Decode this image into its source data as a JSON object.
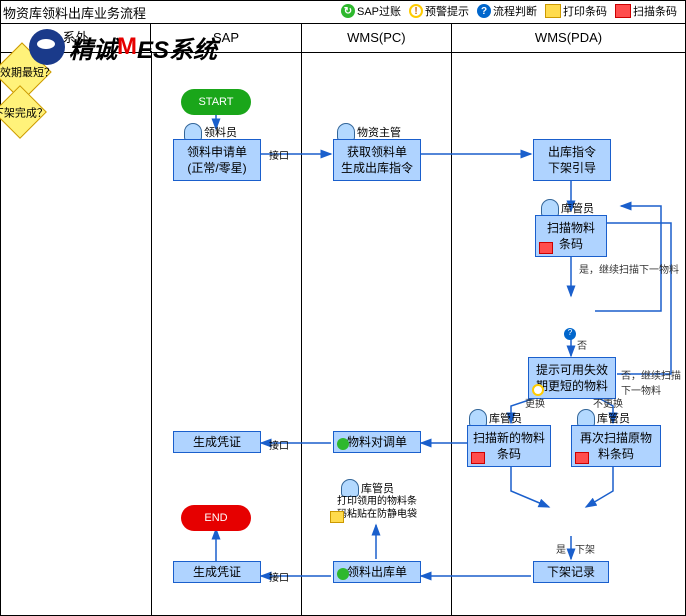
{
  "title": "物资库领料出库业务流程",
  "legend": {
    "sap": "SAP过账",
    "warn": "预警提示",
    "judge": "流程判断",
    "print": "打印条码",
    "scan": "扫描条码"
  },
  "cols": {
    "c1": "系外",
    "c2": "SAP",
    "c3": "WMS(PC)",
    "c4": "WMS(PDA)"
  },
  "logo": {
    "pre": "精诚",
    "mid": "M",
    "suf": "ES系统"
  },
  "nodes": {
    "start": "START",
    "end": "END",
    "apply": {
      "l1": "领料申请单",
      "l2": "(正常/零星)"
    },
    "fetch": {
      "l1": "获取领料单",
      "l2": "生成出库指令"
    },
    "guide": {
      "l1": "出库指令",
      "l2": "下架引导"
    },
    "scanMat": {
      "l1": "扫描物料",
      "l2": "条码"
    },
    "expiry": "失效期最短？",
    "hint": {
      "l1": "提示可用失效",
      "l2": "期更短的物料"
    },
    "scanNew": {
      "l1": "扫描新的物料",
      "l2": "条码"
    },
    "scanOld": {
      "l1": "再次扫描原物",
      "l2": "料条码"
    },
    "done": "下架完成？",
    "record": "下架记录",
    "outbound": "领料出库单",
    "adjust": "物料对调单",
    "voucher1": "生成凭证",
    "voucher2": "生成凭证",
    "stick": {
      "l1": "打印领用的物料条",
      "l2": "码粘贴在防静电袋"
    }
  },
  "actors": {
    "picker": "领料员",
    "supervisor": "物资主管",
    "keeper": "库管员"
  },
  "labels": {
    "iface": "接口",
    "yes": "是，继续扫描下一物料",
    "no": "否",
    "noCont": "否，继续扫描下一物料",
    "change": "更换",
    "nochange": "不更换",
    "yes2": "是",
    "off": "下架"
  }
}
